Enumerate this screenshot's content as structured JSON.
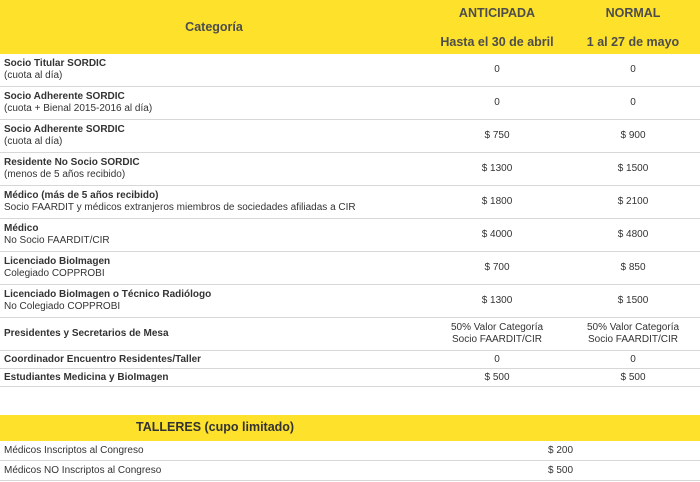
{
  "header": {
    "categoria": "Categoría",
    "anticipada": "ANTICIPADA",
    "anticipada_fecha": "Hasta el 30 de abril",
    "normal": "NORMAL",
    "normal_fecha": "1 al 27 de mayo"
  },
  "rows": [
    {
      "title": "Socio Titular SORDIC",
      "sub": "(cuota al día)",
      "anticipada": "0",
      "normal": "0"
    },
    {
      "title": "Socio Adherente SORDIC",
      "sub": "(cuota + Bienal 2015-2016 al día)",
      "anticipada": "0",
      "normal": "0"
    },
    {
      "title": "Socio Adherente SORDIC",
      "sub": "(cuota al día)",
      "anticipada": "$ 750",
      "normal": "$ 900"
    },
    {
      "title": "Residente No Socio SORDIC",
      "sub": "(menos de 5 años recibido)",
      "anticipada": "$ 1300",
      "normal": "$ 1500"
    },
    {
      "title": "Médico (más de 5 años recibido)",
      "sub": "Socio FAARDIT y médicos extranjeros miembros de sociedades afiliadas a CIR",
      "anticipada": "$ 1800",
      "normal": "$ 2100"
    },
    {
      "title": "Médico",
      "sub": "No Socio FAARDIT/CIR",
      "anticipada": "$ 4000",
      "normal": "$ 4800"
    },
    {
      "title": "Licenciado BioImagen",
      "sub": "Colegiado COPPROBI",
      "anticipada": "$ 700",
      "normal": "$ 850"
    },
    {
      "title": "Licenciado BioImagen o Técnico Radiólogo",
      "sub": "No Colegiado COPPROBI",
      "anticipada": "$ 1300",
      "normal": "$ 1500"
    },
    {
      "title": "Presidentes y Secretarios de Mesa",
      "anticipada_l1": "50% Valor Categoría",
      "anticipada_l2": "Socio FAARDIT/CIR",
      "normal_l1": "50% Valor Categoría",
      "normal_l2": "Socio FAARDIT/CIR"
    },
    {
      "title": "Coordinador Encuentro Residentes/Taller",
      "anticipada": "0",
      "normal": "0"
    },
    {
      "title": "Estudiantes Medicina y BioImagen",
      "anticipada": "$ 500",
      "normal": "$ 500"
    }
  ],
  "talleres": {
    "title": "TALLERES (cupo limitado)",
    "items": [
      {
        "label": "Médicos Inscriptos al Congreso",
        "price": "$ 200"
      },
      {
        "label": "Médicos NO Inscriptos al Congreso",
        "price": "$ 500"
      }
    ]
  },
  "colors": {
    "accent": "#fde12a",
    "border": "#d7d7d7"
  }
}
